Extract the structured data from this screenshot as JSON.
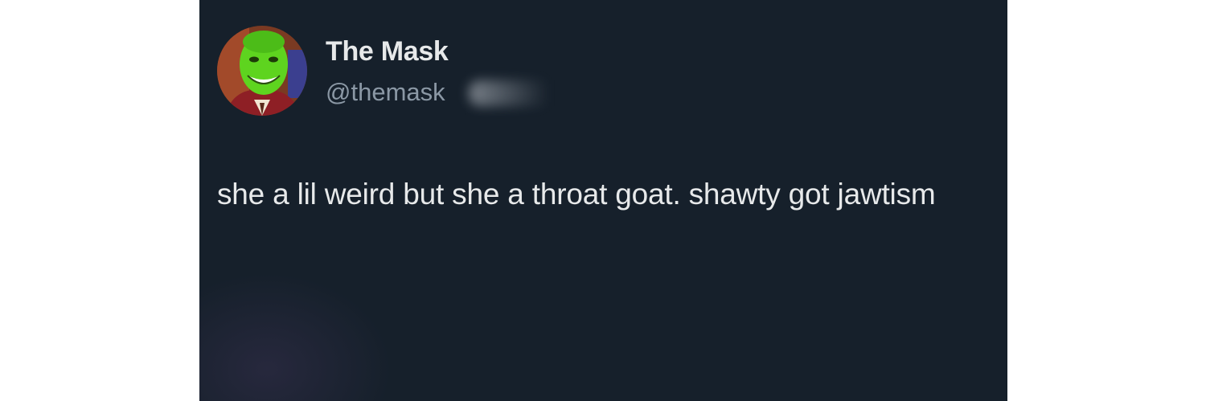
{
  "tweet": {
    "author": {
      "display_name": "The Mask",
      "handle": "@themask",
      "avatar_icon": "avatar-green-mask-face"
    },
    "text": "she a lil weird but she a throat goat. shawty got jawtism"
  },
  "colors": {
    "card_background": "#16202b",
    "text_primary": "#e7e9ea",
    "text_secondary": "#8b98a5",
    "page_background": "#ffffff"
  }
}
